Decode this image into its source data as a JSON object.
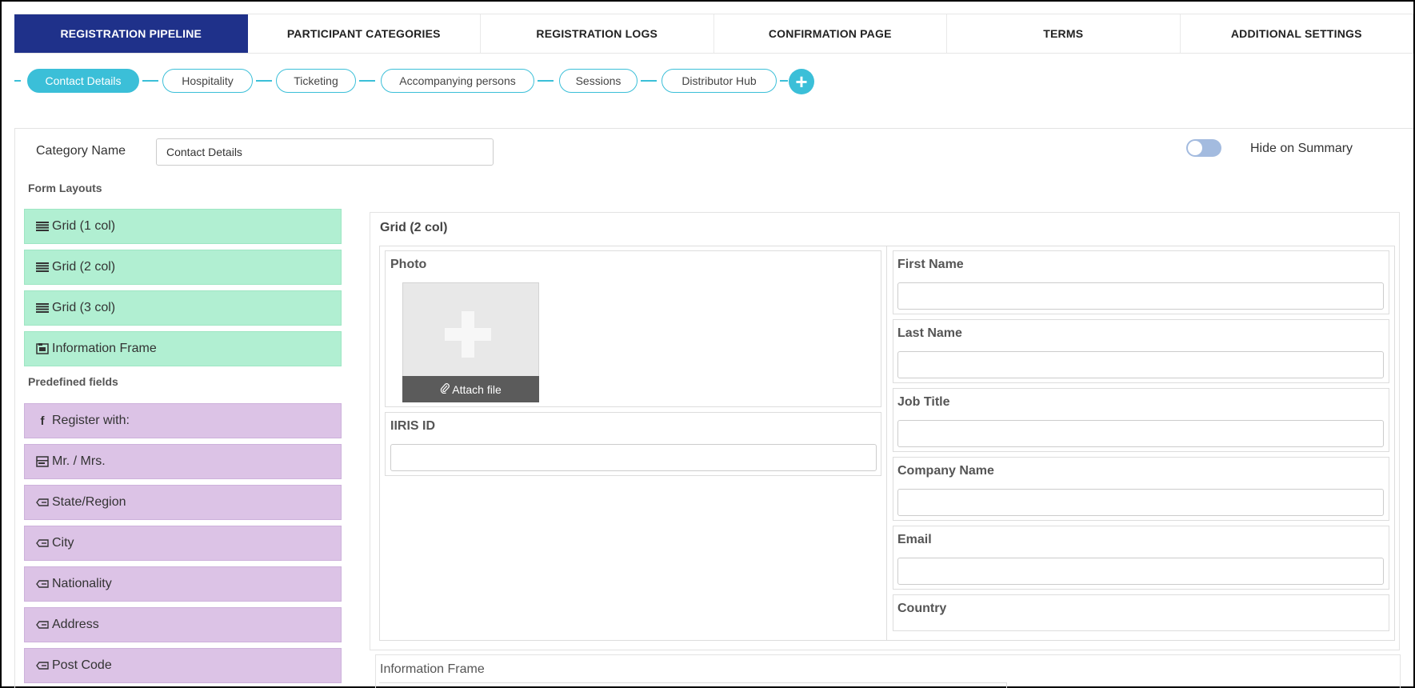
{
  "tabs": [
    {
      "label": "REGISTRATION PIPELINE",
      "active": true
    },
    {
      "label": "PARTICIPANT CATEGORIES"
    },
    {
      "label": "REGISTRATION LOGS"
    },
    {
      "label": "CONFIRMATION PAGE"
    },
    {
      "label": "TERMS"
    },
    {
      "label": "ADDITIONAL SETTINGS"
    }
  ],
  "pipeline": {
    "steps": [
      "Contact Details",
      "Hospitality",
      "Ticketing",
      "Accompanying persons",
      "Sessions",
      "Distributor Hub"
    ],
    "active_step": "Contact Details",
    "add_icon": "plus-circle-icon",
    "accent_color": "#3bbfd8"
  },
  "category": {
    "label": "Category Name",
    "value": "Contact Details",
    "toggle_label": "Hide on Summary",
    "toggle_on": false
  },
  "form_layouts": {
    "heading": "Form Layouts",
    "items": [
      {
        "label": "Grid (1 col)",
        "icon": "list-icon"
      },
      {
        "label": "Grid (2 col)",
        "icon": "list-icon"
      },
      {
        "label": "Grid (3 col)",
        "icon": "list-icon"
      },
      {
        "label": "Information Frame",
        "icon": "frame-icon"
      }
    ],
    "color": "#b1efd2"
  },
  "predefined_fields": {
    "heading": "Predefined fields",
    "items": [
      {
        "label": "Register with:",
        "icon": "facebook-icon"
      },
      {
        "label": "Mr. / Mrs.",
        "icon": "select-icon"
      },
      {
        "label": "State/Region",
        "icon": "tag-icon"
      },
      {
        "label": "City",
        "icon": "tag-icon"
      },
      {
        "label": "Nationality",
        "icon": "tag-icon"
      },
      {
        "label": "Address",
        "icon": "tag-icon"
      },
      {
        "label": "Post Code",
        "icon": "tag-icon"
      }
    ],
    "color": "#dcc3e6"
  },
  "preview": {
    "grid_title": "Grid (2 col)",
    "left_column": {
      "photo_label": "Photo",
      "attach_label": "Attach file",
      "iris_label": "IIRIS ID"
    },
    "right_column": [
      "First Name",
      "Last Name",
      "Job Title",
      "Company Name",
      "Email",
      "Country"
    ],
    "info_frame_title": "Information Frame"
  }
}
